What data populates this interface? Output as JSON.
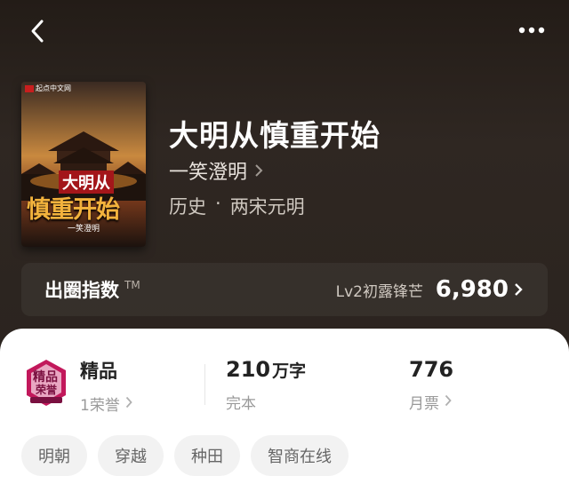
{
  "nav": {
    "back_icon": "chevron-left-icon",
    "more_icon": "more-dots-icon"
  },
  "book": {
    "cover_publisher": "起点中文网",
    "cover_title_top": "大明从",
    "cover_title_main": "慎重开始",
    "cover_author": "一笑澄明",
    "title": "大明从慎重开始",
    "author": "一笑澄明",
    "genre": "历史",
    "genre_separator": "·",
    "subgenre": "两宋元明"
  },
  "index": {
    "label": "出圈指数",
    "tm": "TM",
    "level": "Lv2初露锋芒",
    "value": "6,980"
  },
  "stats": {
    "badge_text": "精品",
    "badge_sub": "1荣誉",
    "badge_art_line1": "精品",
    "badge_art_line2": "荣誉",
    "words_value": "210",
    "words_unit": "万字",
    "words_status": "完本",
    "tickets_value": "776",
    "tickets_label": "月票"
  },
  "tags": [
    "明朝",
    "穿越",
    "种田",
    "智商在线"
  ],
  "colors": {
    "hero_bg": "#2a2420",
    "panel_bg": "#ffffff",
    "tag_bg": "#f2f2f2",
    "badge_accent": "#c2185b"
  }
}
